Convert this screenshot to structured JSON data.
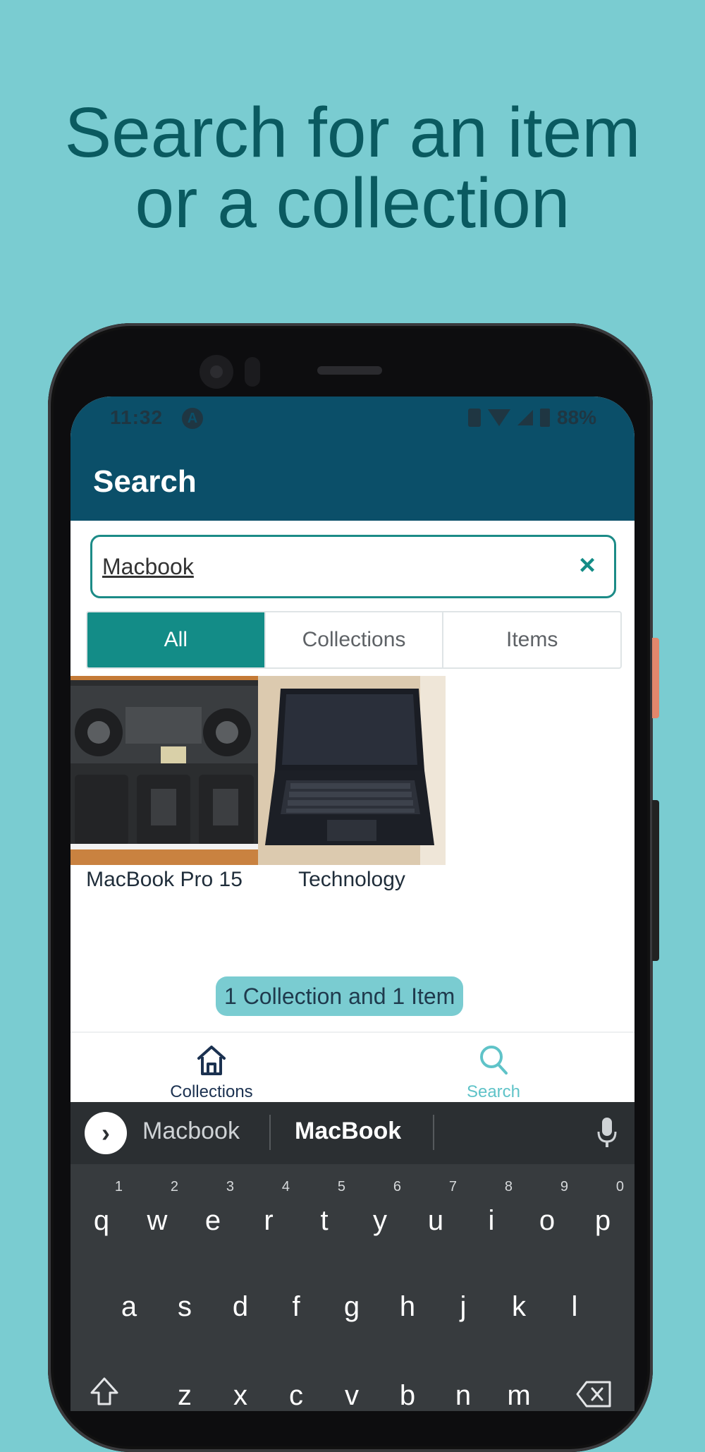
{
  "headline": [
    "Search for an item",
    "or a collection"
  ],
  "status_bar": {
    "time": "11:32",
    "app_icon_letter": "A",
    "battery": "88%"
  },
  "app_bar": {
    "title": "Search"
  },
  "search": {
    "value": "Macbook",
    "clear_icon": "×"
  },
  "filter_tabs": [
    {
      "label": "All",
      "active": true
    },
    {
      "label": "Collections",
      "active": false
    },
    {
      "label": "Items",
      "active": false
    }
  ],
  "results": [
    {
      "label": "MacBook Pro 15"
    },
    {
      "label": "Technology"
    }
  ],
  "summary": "1 Collection and 1 Item",
  "bottom_nav": [
    {
      "label": "Collections",
      "icon": "home-icon"
    },
    {
      "label": "Search",
      "icon": "search-icon",
      "active": true
    }
  ],
  "keyboard": {
    "suggestions": [
      "Macbook",
      "MacBook"
    ],
    "row1": [
      "q",
      "w",
      "e",
      "r",
      "t",
      "y",
      "u",
      "i",
      "o",
      "p"
    ],
    "row1_nums": [
      "1",
      "2",
      "3",
      "4",
      "5",
      "6",
      "7",
      "8",
      "9",
      "0"
    ],
    "row2": [
      "a",
      "s",
      "d",
      "f",
      "g",
      "h",
      "j",
      "k",
      "l"
    ],
    "row3": [
      "z",
      "x",
      "c",
      "v",
      "b",
      "n",
      "m"
    ]
  },
  "colors": {
    "page_background": "#7accd1",
    "headline": "#0a5a60",
    "app_bar": "#0b4f69",
    "accent": "#138c87",
    "nav_active": "#5fc3c8"
  }
}
